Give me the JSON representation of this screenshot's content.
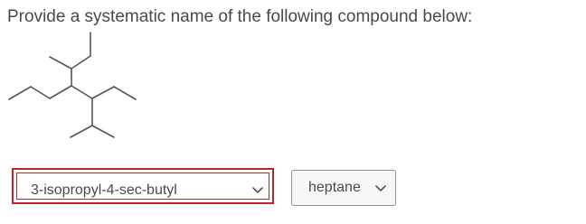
{
  "question": {
    "text": "Provide a systematic name of the following compound below:"
  },
  "answer": {
    "substituents_select": {
      "selected": "3-isopropyl-4-sec-butyl",
      "state": "invalid"
    },
    "parent_chain_select": {
      "selected": "heptane"
    }
  },
  "colors": {
    "error_border": "#b8252a",
    "text": "#494949"
  },
  "icons": {
    "dropdown": "chevron-down-icon"
  }
}
